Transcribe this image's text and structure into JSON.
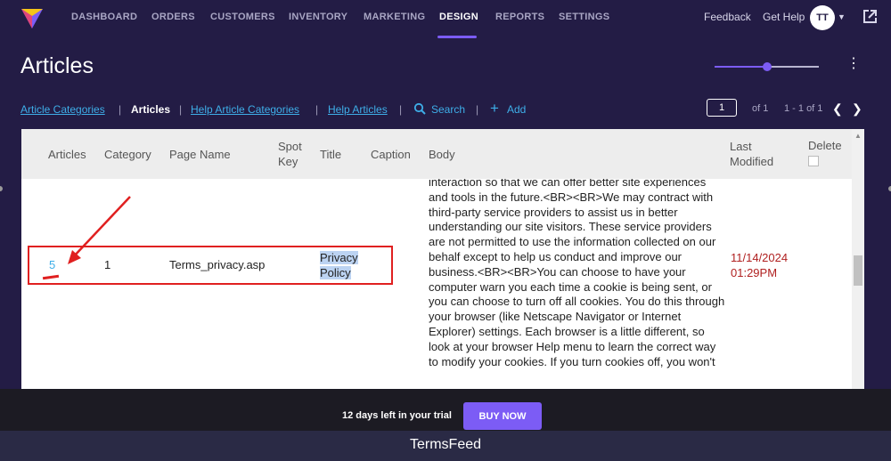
{
  "nav": {
    "items": [
      "DASHBOARD",
      "ORDERS",
      "CUSTOMERS",
      "INVENTORY",
      "MARKETING",
      "DESIGN",
      "REPORTS",
      "SETTINGS"
    ],
    "active": "DESIGN",
    "feedback": "Feedback",
    "help": "Get Help",
    "avatar_initials": "TT"
  },
  "header": {
    "title": "Articles",
    "slider_value": 0.5
  },
  "breadcrumbs": {
    "categories": "Article Categories",
    "articles": "Articles",
    "help_categories": "Help Article Categories",
    "help_articles": "Help Articles",
    "search": "Search",
    "add": "Add",
    "separator": "|"
  },
  "pagination": {
    "page": "1",
    "of": "of 1",
    "range": "1 - 1 of 1"
  },
  "table": {
    "headers": {
      "articles": "Articles",
      "category": "Category",
      "page_name": "Page Name",
      "spot_key_1": "Spot",
      "spot_key_2": "Key",
      "title": "Title",
      "caption": "Caption",
      "body": "Body",
      "last_modified_1": "Last",
      "last_modified_2": "Modified",
      "delete": "Delete"
    },
    "row": {
      "articles": "5",
      "category": "1",
      "page_name": "Terms_privacy.asp",
      "title_1": "Privacy",
      "title_2": "Policy",
      "body": "interaction so that we can offer better site experiences and tools in the future.<BR><BR>We may contract with third-party service providers to assist us in better understanding our site visitors. These service providers are not permitted to use the information collected on our behalf except to help us conduct and improve our business.<BR><BR>You can choose to have your computer warn you each time a cookie is being sent, or you can choose to turn off all cookies. You do this through your browser (like Netscape Navigator or Internet Explorer) settings. Each browser is a little different, so look at your browser Help menu to learn the correct way to modify your cookies. If you turn cookies off, you won't",
      "date": "11/14/2024",
      "time": "01:29PM"
    }
  },
  "trial": {
    "text": "12 days left in your trial",
    "button": "BUY NOW"
  },
  "footer": {
    "label": "TermsFeed"
  },
  "colors": {
    "nav_bg": "#231c45",
    "accent": "#7c5cf5",
    "link": "#3eaee8",
    "annotation": "#e02020",
    "date": "#b02020"
  }
}
